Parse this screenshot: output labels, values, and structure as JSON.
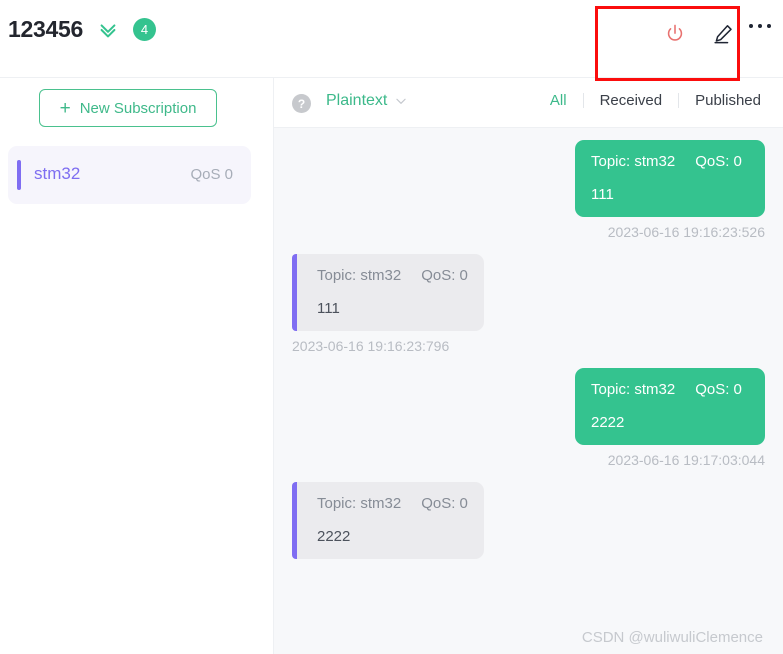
{
  "header": {
    "connection_title": "123456",
    "collapse_icon": "double-chevron-down-icon",
    "badge_count": "4",
    "disconnect_icon": "power-icon",
    "edit_icon": "pencil-icon",
    "more_icon": "more-horizontal-icon",
    "accent_green": "#34c38f",
    "power_red": "#e8716f"
  },
  "sidebar": {
    "new_subscription_label": "New Subscription",
    "plus_glyph": "+",
    "subscriptions": [
      {
        "topic": "stm32",
        "qos": "QoS 0"
      }
    ]
  },
  "toolbar": {
    "help_icon": "question-circle-icon",
    "help_glyph": "?",
    "format_label": "Plaintext",
    "format_chevron": "chevron-down-icon",
    "filters": [
      {
        "label": "All",
        "active": true
      },
      {
        "label": "Received",
        "active": false
      },
      {
        "label": "Published",
        "active": false
      }
    ]
  },
  "messages": [
    {
      "direction": "published",
      "topic": "Topic: stm32",
      "qos": "QoS: 0",
      "payload": "111",
      "time": "2023-06-16 19:16:23:526"
    },
    {
      "direction": "received",
      "topic": "Topic: stm32",
      "qos": "QoS: 0",
      "payload": "111",
      "time": "2023-06-16 19:16:23:796"
    },
    {
      "direction": "published",
      "topic": "Topic: stm32",
      "qos": "QoS: 0",
      "payload": "2222",
      "time": "2023-06-16 19:17:03:044"
    },
    {
      "direction": "received",
      "topic": "Topic: stm32",
      "qos": "QoS: 0",
      "payload": "2222",
      "time": ""
    }
  ],
  "watermark": "CSDN @wuliwuliClemence"
}
